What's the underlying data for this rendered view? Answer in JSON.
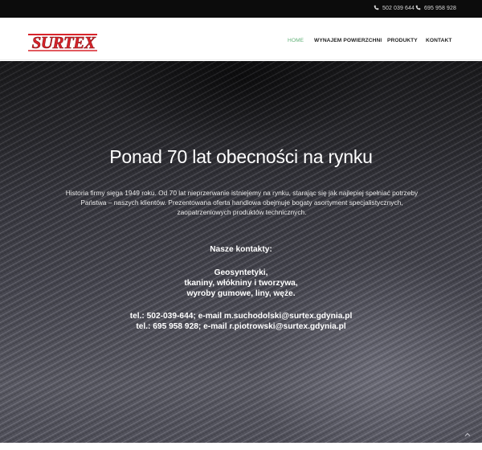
{
  "topbar": {
    "phones": [
      {
        "icon": "phone-icon",
        "number": "502 039 644"
      },
      {
        "icon": "phone-icon",
        "number": "695 958 928"
      }
    ]
  },
  "header": {
    "logo_text": "SURTEX",
    "nav": [
      {
        "label": "HOME",
        "active": true
      },
      {
        "label": "WYNAJEM POWIERZCHNI",
        "active": false
      },
      {
        "label": "PRODUKTY",
        "active": false
      },
      {
        "label": "KONTAKT",
        "active": false
      }
    ]
  },
  "hero": {
    "title": "Ponad 70 lat obecności na rynku",
    "description": "Historia firmy sięga 1949 roku. Od 70 lat nieprzerwanie istniejemy na rynku, starając się jak najlepiej spełniać potrzeby Państwa – naszych klientów. Prezentowana oferta handlowa obejmuje bogaty asortyment specjalistycznych, zaopatrzeniowych produktów technicznych.",
    "contacts_title": "Nasze kontakty:",
    "product_lines": [
      "Geosyntetyki,",
      "tkaniny, włókniny i tworzywa,",
      "wyroby gumowe, liny, węże."
    ],
    "tel_lines": [
      "tel.: 502-039-644; e-mail m.suchodolski@surtex.gdynia.pl",
      "tel.: 695 958 928; e-mail r.piotrowski@surtex.gdynia.pl"
    ]
  },
  "colors": {
    "accent_green": "#62b178",
    "logo_red": "#d8232a",
    "topbar_bg": "#0c0c0c"
  },
  "scroll_top_icon": "chevron-up-icon"
}
